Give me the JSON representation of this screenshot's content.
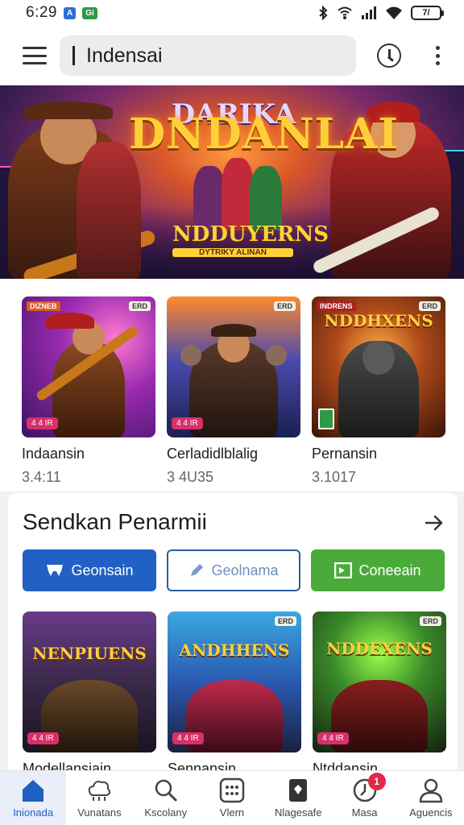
{
  "status_bar": {
    "time": "6:29",
    "badge_1": "A",
    "badge_2": "Gi",
    "battery": "7/"
  },
  "top_bar": {
    "search_value": "Indensai"
  },
  "hero": {
    "title_top": "DARIKA",
    "title_main": "DNDANLAI",
    "subtitle": "NDDUYERNS",
    "sub_tagline": "DYTRIKY ALINAN"
  },
  "featured_games": [
    {
      "name": "Indaansin",
      "meta": "3.4:11",
      "tag_left": "DIZNEB",
      "tag_right": "ERD",
      "badge": "4 4 IR"
    },
    {
      "name": "Cerladidlblalig",
      "meta": "3 4U35",
      "tag_left": "",
      "tag_right": "ERD",
      "badge": "4 4 IR"
    },
    {
      "name": "Pernansin",
      "meta": "3.1017",
      "tag_left": "INDRENS",
      "tag_right": "ERD",
      "badge": "",
      "thumb_title": "NDDHXENS"
    }
  ],
  "section": {
    "title": "Sendkan Penarmii",
    "chips": [
      {
        "label": "Geonsain",
        "style": "blue"
      },
      {
        "label": "Geolnama",
        "style": "outline"
      },
      {
        "label": "Coneeain",
        "style": "green"
      }
    ],
    "games": [
      {
        "name": "Modellansiain",
        "thumb_title": "NENPIUENS",
        "tag_right": "",
        "badge": "4 4 IR"
      },
      {
        "name": "Sennansin",
        "thumb_title": "ANDHHENS",
        "tag_right": "ERD",
        "badge": "4 4 IR"
      },
      {
        "name": "Ntddansin",
        "thumb_title": "NDDEXENS",
        "tag_right": "ERD",
        "badge": "4 4 IR"
      }
    ]
  },
  "bottom_nav": [
    {
      "label": "Inionada",
      "icon": "home-icon"
    },
    {
      "label": "Vunatans",
      "icon": "cloud-group-icon"
    },
    {
      "label": "Kscolany",
      "icon": "search-icon"
    },
    {
      "label": "Vlern",
      "icon": "grid-icon"
    },
    {
      "label": "Nlagesafe",
      "icon": "shield-icon"
    },
    {
      "label": "Masa",
      "icon": "clock-icon",
      "badge": "1"
    },
    {
      "label": "Aguencis",
      "icon": "person-icon"
    }
  ],
  "colors": {
    "accent_blue": "#2160c4",
    "accent_green": "#4aab3a",
    "badge_red": "#e3264a"
  }
}
